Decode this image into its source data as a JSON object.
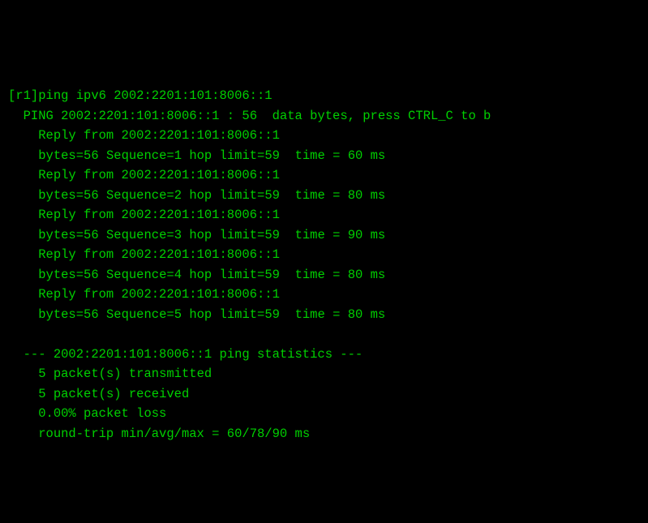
{
  "prompt": {
    "host": "r1",
    "command": "ping ipv6 2002:2201:101:8006::1"
  },
  "header": {
    "label": "PING",
    "target": "2002:2201:101:8006::1",
    "size": 56,
    "text_after": "data bytes, press CTRL_C to b"
  },
  "replies": [
    {
      "from": "2002:2201:101:8006::1",
      "bytes": 56,
      "sequence": 1,
      "hop_limit": 59,
      "time_ms": 60
    },
    {
      "from": "2002:2201:101:8006::1",
      "bytes": 56,
      "sequence": 2,
      "hop_limit": 59,
      "time_ms": 80
    },
    {
      "from": "2002:2201:101:8006::1",
      "bytes": 56,
      "sequence": 3,
      "hop_limit": 59,
      "time_ms": 90
    },
    {
      "from": "2002:2201:101:8006::1",
      "bytes": 56,
      "sequence": 4,
      "hop_limit": 59,
      "time_ms": 80
    },
    {
      "from": "2002:2201:101:8006::1",
      "bytes": 56,
      "sequence": 5,
      "hop_limit": 59,
      "time_ms": 80
    }
  ],
  "stats": {
    "target": "2002:2201:101:8006::1",
    "title_suffix": "ping statistics",
    "transmitted": 5,
    "received": 5,
    "loss_pct": "0.00%",
    "rtt": {
      "min": 60,
      "avg": 78,
      "max": 90,
      "unit": "ms"
    }
  },
  "labels": {
    "reply_from": "Reply from",
    "bytes": "bytes",
    "sequence": "Sequence",
    "hop_limit": "hop limit",
    "time": "time",
    "ms": "ms",
    "packets_transmitted": "packet(s) transmitted",
    "packets_received": "packet(s) received",
    "packet_loss": "packet loss",
    "round_trip": "round-trip min/avg/max"
  }
}
